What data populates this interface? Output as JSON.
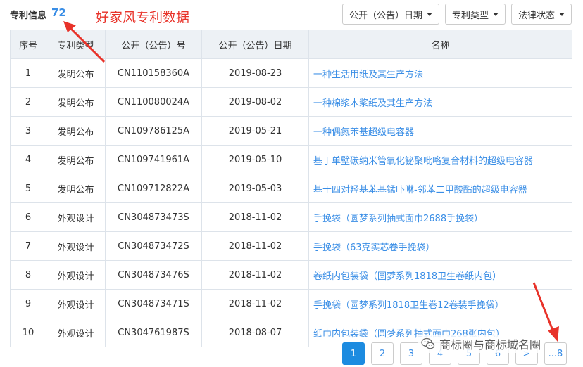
{
  "header": {
    "title": "专利信息",
    "count": "72",
    "overlay": "好家风专利数据",
    "filters": {
      "date": "公开（公告）日期",
      "type": "专利类型",
      "status": "法律状态"
    }
  },
  "table": {
    "columns": {
      "index": "序号",
      "type": "专利类型",
      "number": "公开（公告）号",
      "date": "公开（公告）日期",
      "name": "名称"
    },
    "rows": [
      {
        "index": "1",
        "type": "发明公布",
        "number": "CN110158360A",
        "date": "2019-08-23",
        "name": "一种生活用纸及其生产方法"
      },
      {
        "index": "2",
        "type": "发明公布",
        "number": "CN110080024A",
        "date": "2019-08-02",
        "name": "一种棉浆木浆纸及其生产方法"
      },
      {
        "index": "3",
        "type": "发明公布",
        "number": "CN109786125A",
        "date": "2019-05-21",
        "name": "一种偶氮苯基超级电容器"
      },
      {
        "index": "4",
        "type": "发明公布",
        "number": "CN109741961A",
        "date": "2019-05-10",
        "name": "基于单壁碳纳米管氧化铋聚吡咯复合材料的超级电容器"
      },
      {
        "index": "5",
        "type": "发明公布",
        "number": "CN109712822A",
        "date": "2019-05-03",
        "name": "基于四对羟基苯基锰卟啉-邻苯二甲酸酯的超级电容器"
      },
      {
        "index": "6",
        "type": "外观设计",
        "number": "CN304873473S",
        "date": "2018-11-02",
        "name": "手挽袋（圆梦系列抽式面巾2688手挽袋）"
      },
      {
        "index": "7",
        "type": "外观设计",
        "number": "CN304873472S",
        "date": "2018-11-02",
        "name": "手挽袋（63克实芯卷手挽袋）"
      },
      {
        "index": "8",
        "type": "外观设计",
        "number": "CN304873476S",
        "date": "2018-11-02",
        "name": "卷纸内包装袋（圆梦系列1818卫生卷纸内包）"
      },
      {
        "index": "9",
        "type": "外观设计",
        "number": "CN304873471S",
        "date": "2018-11-02",
        "name": "手挽袋（圆梦系列1818卫生卷12卷装手挽袋）"
      },
      {
        "index": "10",
        "type": "外观设计",
        "number": "CN304761987S",
        "date": "2018-08-07",
        "name": "纸巾内包装袋（圆梦系列抽式面巾268张内包）"
      }
    ]
  },
  "pagination": {
    "pages": [
      "1",
      "2",
      "3",
      "4",
      "5",
      "6"
    ],
    "next": ">",
    "last": "...8",
    "current": "1"
  },
  "watermark": {
    "text": "商标圈与商标域名圈",
    "icon": "wechat-icon"
  },
  "colors": {
    "accent": "#1c8be0",
    "link": "#3a8ee6",
    "annotation": "#e8332a",
    "header_bg": "#edf1f5"
  }
}
